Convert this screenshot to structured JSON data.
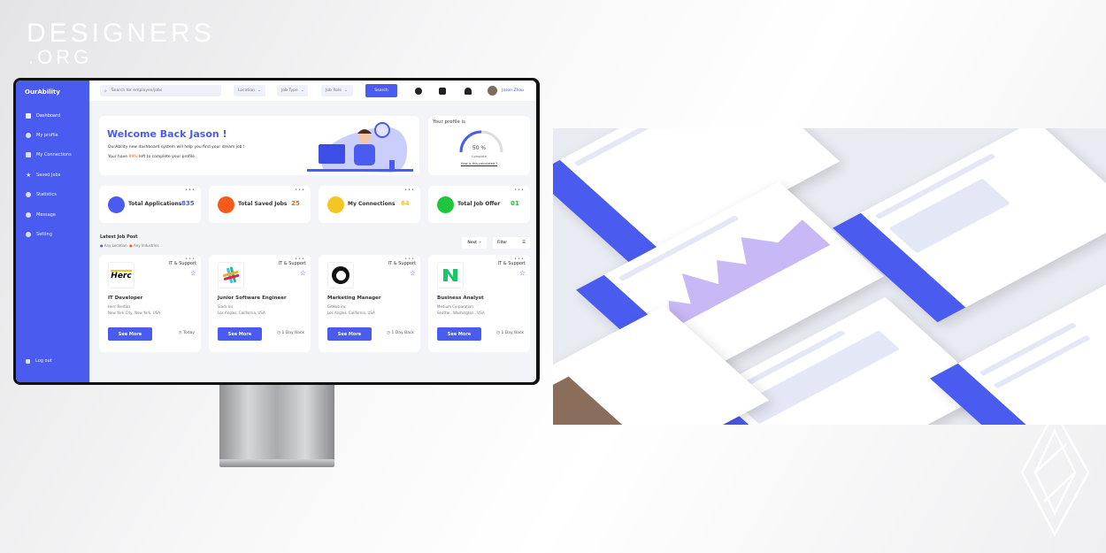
{
  "brand": {
    "line1": "DESIGNERS",
    "line2": ".ORG"
  },
  "app": {
    "logo": "OurAbility"
  },
  "sidebar": {
    "items": [
      {
        "label": "Dashboard",
        "icon": "dashboard-icon"
      },
      {
        "label": "My profile",
        "icon": "user-icon"
      },
      {
        "label": "My Connections",
        "icon": "users-icon"
      },
      {
        "label": "Saved Jobs",
        "icon": "star-icon"
      },
      {
        "label": "Statistics",
        "icon": "pie-chart-icon"
      },
      {
        "label": "Message",
        "icon": "chat-icon"
      },
      {
        "label": "Setting",
        "icon": "gear-icon"
      }
    ],
    "logout": "Log out"
  },
  "topbar": {
    "search_placeholder": "Search for employee/jobs",
    "location": "Location",
    "job_type": "Job Type",
    "job_role": "Job Role",
    "search_button": "Search",
    "user_name": "Jason Zhou"
  },
  "welcome": {
    "title": "Welcome Back Jason !",
    "subtitle": "OurAbility new dashboard system will help you find your dream job !",
    "progress_prefix": "Your have ",
    "progress_value": "99%",
    "progress_suffix": " left to complete your profile."
  },
  "profile": {
    "title": "Your profile is",
    "percent_label": "50 %",
    "percent": 50,
    "status": "Complete",
    "link": "How is this calculated ?"
  },
  "stats": [
    {
      "label": "Total Applications",
      "value": "835",
      "color": "#4a5cf0"
    },
    {
      "label": "Total Saved Jobs",
      "value": "25",
      "color": "#f45b1b"
    },
    {
      "label": "My Connections",
      "value": "64",
      "color": "#f3c623"
    },
    {
      "label": "Total Job Offer",
      "value": "01",
      "color": "#1fc53d"
    }
  ],
  "jobs_section": {
    "title": "Latest Job Post",
    "filter1": "Any Location",
    "filter2": "Any Industries",
    "next": "Next",
    "filter": "Filter"
  },
  "jobs": [
    {
      "category": "IT & Support",
      "title": "IT Developer",
      "company": "Herc Rentals",
      "location": "New York City, New York, USA",
      "button": "See More",
      "posted": "Today",
      "logo_text": "Herc"
    },
    {
      "category": "IT & Support",
      "title": "Junior Software Engineer",
      "company": "Slack inc",
      "location": "Los Angles, California, USA",
      "button": "See More",
      "posted": "1 Day Back"
    },
    {
      "category": "IT & Support",
      "title": "Marketing Manager",
      "company": "GitHub inc",
      "location": "Los Angles, California, USA",
      "button": "See More",
      "posted": "1 Day Back"
    },
    {
      "category": "IT & Support",
      "title": "Business Analyst",
      "company": "Medium Corporation",
      "location": "Seattle , Washington , USA",
      "button": "See More",
      "posted": "1 Day Back"
    }
  ],
  "colors": {
    "accent": "#4a5cf0",
    "highlight": "#f45b1b"
  }
}
